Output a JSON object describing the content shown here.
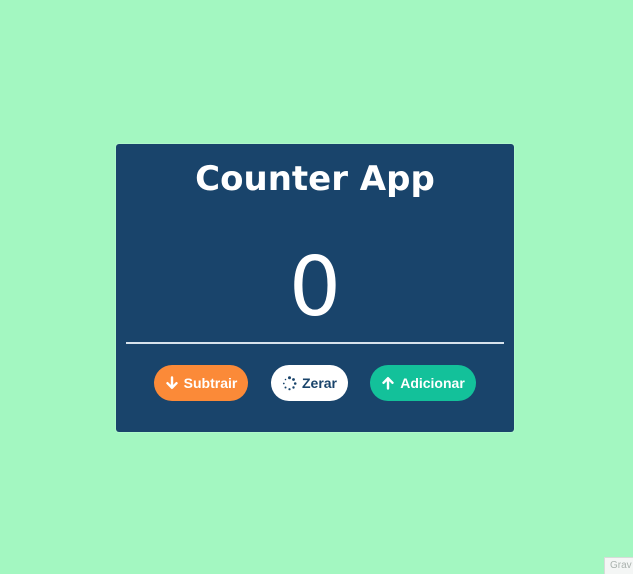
{
  "app": {
    "title": "Counter App",
    "count": "0"
  },
  "buttons": {
    "subtract": {
      "label": "Subtrair",
      "icon": "arrow-down-icon"
    },
    "reset": {
      "label": "Zerar",
      "icon": "spinner-icon"
    },
    "add": {
      "label": "Adicionar",
      "icon": "arrow-up-icon"
    }
  },
  "corner_badge": {
    "text": "Grav"
  },
  "colors": {
    "background": "#a3f7c1",
    "card": "#19446b",
    "subtract": "#fb8a38",
    "reset": "#ffffff",
    "add": "#13c19a"
  }
}
